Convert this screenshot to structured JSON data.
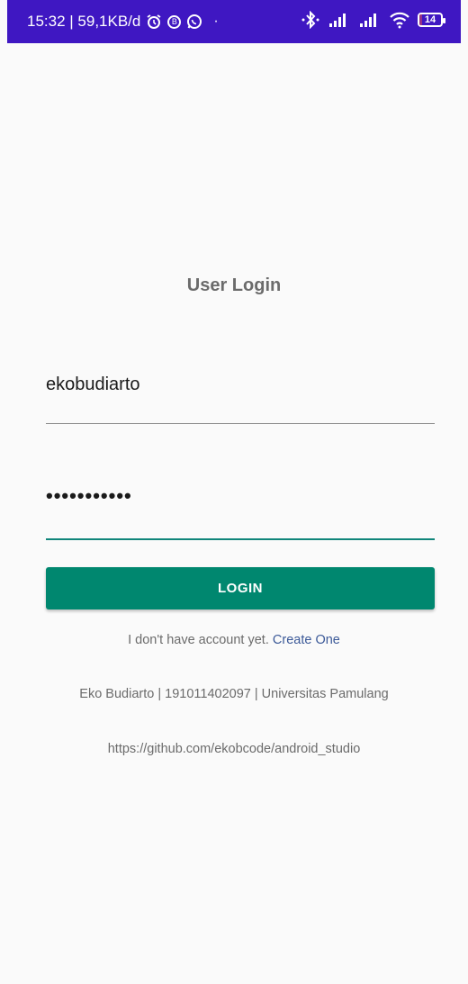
{
  "status_bar": {
    "time_info": "15:32 | 59,1KB/d",
    "app_icons": [
      "alarm-icon",
      "b-badge-icon",
      "whatsapp-icon"
    ],
    "dot": "·",
    "right_icons": [
      "bluetooth-icon",
      "signal-icon",
      "signal-icon",
      "wifi-icon"
    ],
    "battery_level": "14",
    "bar_color": "#3f17c2"
  },
  "login": {
    "title": "User Login",
    "username_value": "ekobudiarto",
    "password_value": "•••••••••••",
    "login_button": "LOGIN",
    "no_account_text": "I don't have account yet.",
    "create_link": "Create One",
    "accent_color": "#00876f"
  },
  "footer": {
    "credits": "Eko Budiarto | 191011402097 | Universitas Pamulang",
    "url": "https://github.com/ekobcode/android_studio"
  }
}
